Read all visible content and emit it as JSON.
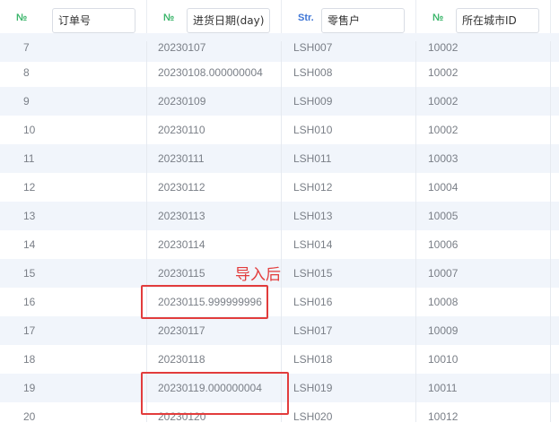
{
  "columns": [
    {
      "type": "№",
      "type_kind": "num",
      "title": "订单号"
    },
    {
      "type": "№",
      "type_kind": "num",
      "title": "进货日期(day)"
    },
    {
      "type": "Str.",
      "type_kind": "str",
      "title": "零售户"
    },
    {
      "type": "№",
      "type_kind": "num",
      "title": "所在城市ID"
    }
  ],
  "rows": [
    [
      "7",
      "20230107",
      "LSH007",
      "10002"
    ],
    [
      "8",
      "20230108.000000004",
      "LSH008",
      "10002"
    ],
    [
      "9",
      "20230109",
      "LSH009",
      "10002"
    ],
    [
      "10",
      "20230110",
      "LSH010",
      "10002"
    ],
    [
      "11",
      "20230111",
      "LSH011",
      "10003"
    ],
    [
      "12",
      "20230112",
      "LSH012",
      "10004"
    ],
    [
      "13",
      "20230113",
      "LSH013",
      "10005"
    ],
    [
      "14",
      "20230114",
      "LSH014",
      "10006"
    ],
    [
      "15",
      "20230115",
      "LSH015",
      "10007"
    ],
    [
      "16",
      "20230115.999999996",
      "LSH016",
      "10008"
    ],
    [
      "17",
      "20230117",
      "LSH017",
      "10009"
    ],
    [
      "18",
      "20230118",
      "LSH018",
      "10010"
    ],
    [
      "19",
      "20230119.000000004",
      "LSH019",
      "10011"
    ],
    [
      "20",
      "20230120",
      "LSH020",
      "10012"
    ]
  ],
  "annotation": {
    "label": "导入后",
    "color": "#e23c3c"
  }
}
